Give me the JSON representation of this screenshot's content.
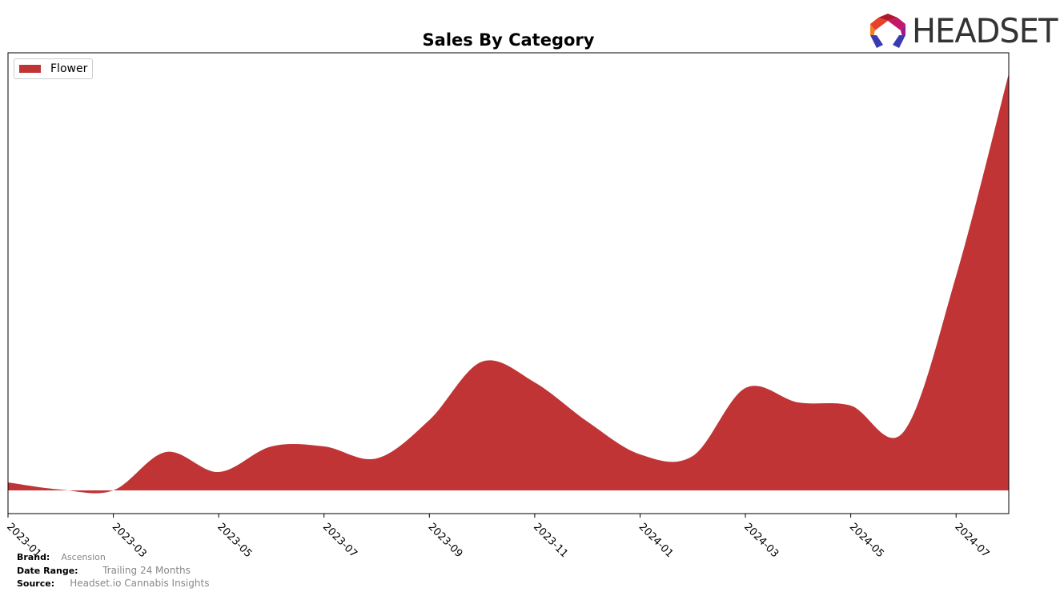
{
  "chart_data": {
    "type": "area",
    "title": "Sales By Category",
    "xlabel": "",
    "ylabel": "",
    "x": [
      "2023-01",
      "2023-02",
      "2023-03",
      "2023-04",
      "2023-05",
      "2023-06",
      "2023-07",
      "2023-08",
      "2023-09",
      "2023-10",
      "2023-11",
      "2023-12",
      "2024-01",
      "2024-02",
      "2024-03",
      "2024-04",
      "2024-05",
      "2024-06",
      "2024-07",
      "2024-08"
    ],
    "x_tick_labels": [
      "2023-01",
      "2023-03",
      "2023-05",
      "2023-07",
      "2023-09",
      "2023-11",
      "2024-01",
      "2024-03",
      "2024-05",
      "2024-07"
    ],
    "series": [
      {
        "name": "Flower",
        "color": "#c13435",
        "values": [
          10,
          1,
          0,
          48,
          23,
          55,
          55,
          40,
          88,
          161,
          135,
          86,
          45,
          43,
          128,
          110,
          106,
          73,
          268,
          521
        ]
      }
    ],
    "ylim": [
      -29,
      547
    ],
    "y_ticks_shown": false,
    "grid": false,
    "legend_position": "top-left"
  },
  "footer": {
    "brand_label": "Brand:",
    "brand_value": "Ascension",
    "date_range_label": "Date Range:",
    "date_range_value": "Trailing 24 Months",
    "source_label": "Source:",
    "source_value": "Headset.io Cannabis Insights"
  },
  "logo": {
    "text": "HEADSET"
  }
}
